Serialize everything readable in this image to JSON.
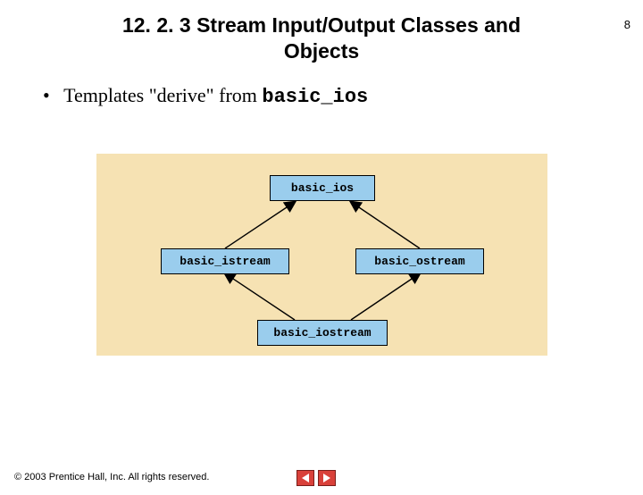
{
  "page_number": "8",
  "title_line1": "12. 2. 3 Stream Input/Output Classes and",
  "title_line2": "Objects",
  "bullet": {
    "dot": "•",
    "text_before_code": "Templates \"derive\" from ",
    "code": "basic_ios"
  },
  "diagram": {
    "nodes": {
      "ios": "basic_ios",
      "istream": "basic_istream",
      "ostream": "basic_ostream",
      "iostream": "basic_iostream"
    }
  },
  "footer": {
    "copyright_symbol": "©",
    "text": " 2003 Prentice Hall, Inc. All rights reserved."
  },
  "colors": {
    "diagram_bg": "#f6e2b3",
    "node_bg": "#9acded",
    "nav_red": "#d9413a"
  }
}
